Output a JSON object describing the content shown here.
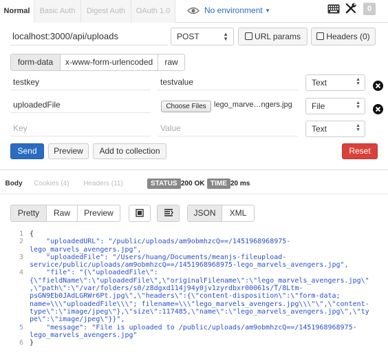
{
  "auth_tabs": [
    "Normal",
    "Basic Auth",
    "Digest Auth",
    "OAuth 1.0"
  ],
  "environment": {
    "label": "No environment"
  },
  "header_badge": "0",
  "request": {
    "url": "localhost:3000/api/uploads",
    "method": "POST",
    "url_params_label": "URL params",
    "headers_label": "Headers (0)"
  },
  "body_tabs": [
    "form-data",
    "x-www-form-urlencoded",
    "raw"
  ],
  "form_rows": [
    {
      "key": "testkey",
      "value": "testvalue",
      "type": "Text"
    },
    {
      "key": "uploadedFile",
      "value_button": "Choose Files",
      "value": "lego_marve…ngers.jpg",
      "type": "File"
    },
    {
      "key_placeholder": "Key",
      "value_placeholder": "Value",
      "type": "Text"
    }
  ],
  "actions": {
    "send": "Send",
    "preview": "Preview",
    "add_to_collection": "Add to collection",
    "reset": "Reset"
  },
  "response_tabs": [
    "Body",
    "Cookies (4)",
    "Headers (11)"
  ],
  "status": {
    "label": "STATUS",
    "value": "200 OK"
  },
  "time": {
    "label": "TIME",
    "value": "20 ms"
  },
  "view_buttons": [
    "Pretty",
    "Raw",
    "Preview"
  ],
  "format_buttons": [
    "JSON",
    "XML"
  ],
  "response_lines": [
    {
      "num": "1",
      "text": "{"
    },
    {
      "num": "2",
      "text": "    \"uploadedURL\": \"/public/uploads/am9obmhzcQ==/1451968968975-"
    },
    {
      "num": "",
      "text": "lego_marvels_avengers.jpg\","
    },
    {
      "num": "3",
      "text": "    \"uploadedFile\": \"/Users/huang/Documents/meanjs-fileupload-"
    },
    {
      "num": "",
      "text": "service/public/uploads/am9obmhzcQ==/1451968968975-lego_marvels_avengers.jpg\","
    },
    {
      "num": "4",
      "text": "    \"file\": \"{\\\"uploadedFile\\\":"
    },
    {
      "num": "",
      "text": "{\\\"fieldName\\\":\\\"uploadedFile\\\",\\\"originalFilename\\\":\\\"lego_marvels_avengers.jpg\\\""
    },
    {
      "num": "",
      "text": ",\\\"path\\\":\\\"/var/folders/s0/z8dgxd114j94y0jv1zyrdbxr00061s/T/8Ltm-"
    },
    {
      "num": "",
      "text": "psGN9Eb0JAdLGRWr6Pt.jpg\\\",\\\"headers\\\":{\\\"content-disposition\\\":\\\"form-data;"
    },
    {
      "num": "",
      "text": "name=\\\\\\\"uploadedFile\\\\\\\"; filename=\\\\\\\"lego_marvels_avengers.jpg\\\\\\\"\\\",\\\"content-"
    },
    {
      "num": "",
      "text": "type\\\":\\\"image/jpeg\\\"},\\\"size\\\":117485,\\\"name\\\":\\\"lego_marvels_avengers.jpg\\\",\\\"ty"
    },
    {
      "num": "",
      "text": "pe\\\":\\\"image/jpeg\\\"}}\","
    },
    {
      "num": "5",
      "text": "    \"message\": \"File is uploaded to /public/uploads/am9obmhzcQ==/1451968968975-"
    },
    {
      "num": "",
      "text": "lego_marvels_avengers.jpg\""
    },
    {
      "num": "6",
      "text": "}"
    }
  ],
  "colors": {
    "send": "#2a6cc2",
    "reset": "#d9413b",
    "link": "#2a6cc2"
  }
}
